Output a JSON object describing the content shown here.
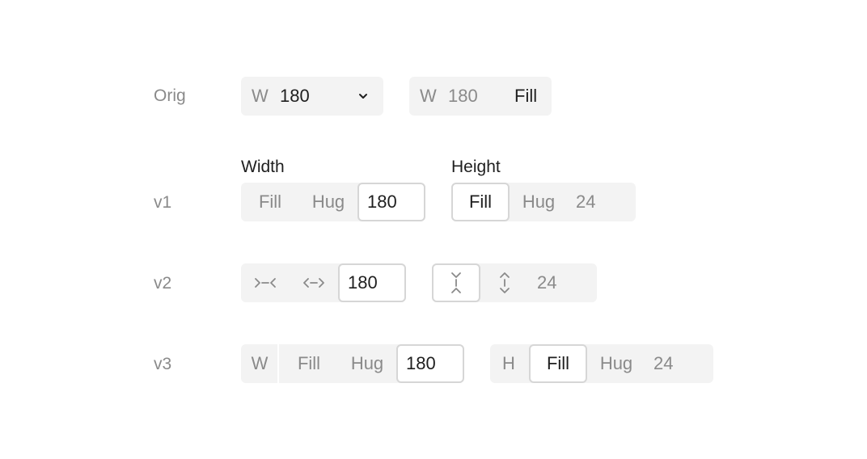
{
  "rows": {
    "orig": {
      "label": "Orig"
    },
    "v1": {
      "label": "v1"
    },
    "v2": {
      "label": "v2"
    },
    "v3": {
      "label": "v3"
    }
  },
  "orig": {
    "width_select": {
      "prefix": "W",
      "value": "180",
      "icon": "chevron-down-icon"
    },
    "width_fill": {
      "prefix": "W",
      "value": "180",
      "mode": "Fill"
    }
  },
  "v1": {
    "width_title": "Width",
    "height_title": "Height",
    "width": {
      "options": [
        "Fill",
        "Hug"
      ],
      "value": "180",
      "selected": "value"
    },
    "height": {
      "options": [
        "Fill",
        "Hug"
      ],
      "value": "24",
      "selected": "Fill"
    }
  },
  "v2": {
    "width": {
      "fill_icon": "shrink-horizontal-icon",
      "hug_icon": "expand-horizontal-icon",
      "value": "180",
      "selected": "value"
    },
    "height": {
      "fill_icon": "shrink-vertical-icon",
      "hug_icon": "expand-vertical-icon",
      "value": "24",
      "selected": "fill"
    }
  },
  "v3": {
    "width": {
      "prefix": "W",
      "options": [
        "Fill",
        "Hug"
      ],
      "value": "180",
      "selected": "value"
    },
    "height": {
      "prefix": "H",
      "options": [
        "Fill",
        "Hug"
      ],
      "value": "24",
      "selected": "Fill"
    }
  },
  "colors": {
    "background": "#ffffff",
    "control_bg": "#f3f3f3",
    "selected_border": "#d6d6d6",
    "muted_text": "#8a8a8a",
    "text": "#1f1f1f"
  }
}
